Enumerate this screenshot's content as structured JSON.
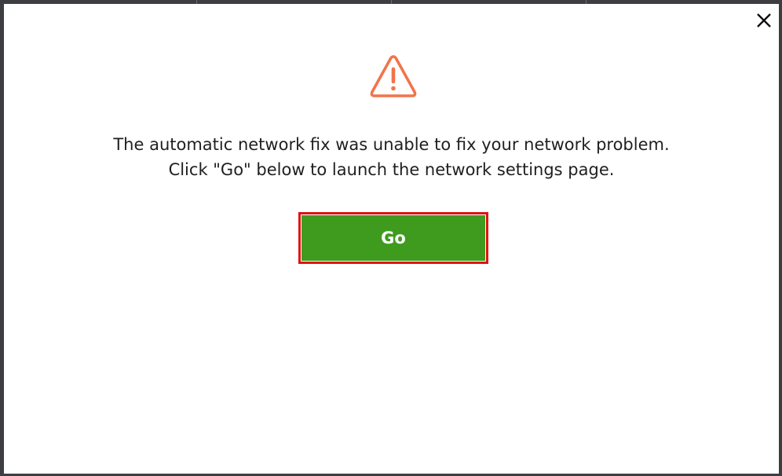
{
  "dialog": {
    "icon": "warning-triangle-icon",
    "message_line1": "The automatic network fix was unable to fix your network problem.",
    "message_line2": "Click \"Go\" below to launch the network settings page.",
    "go_label": "Go",
    "close_icon": "close-icon"
  },
  "colors": {
    "warning": "#f2744a",
    "go_button": "#3f9b1e",
    "go_border": "#e11212",
    "backdrop": "#3c3e42"
  }
}
